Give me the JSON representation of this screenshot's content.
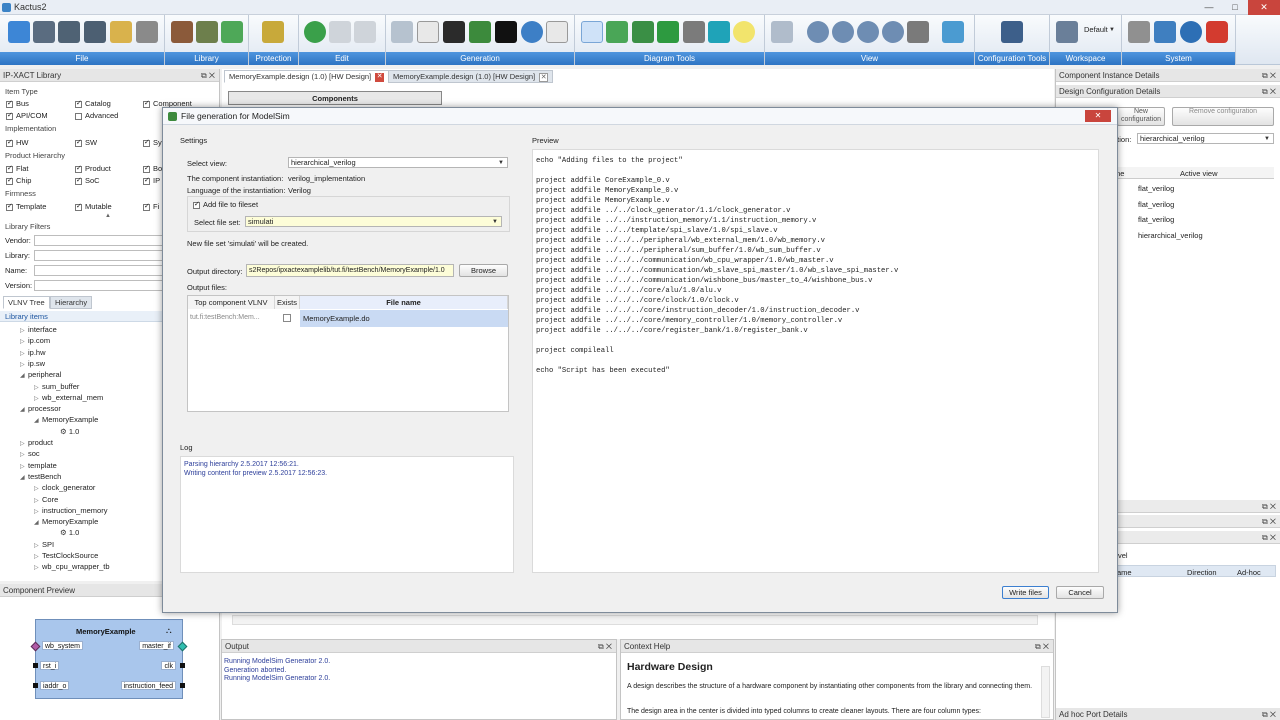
{
  "window": {
    "title": "Kactus2",
    "min": "—",
    "max": "□",
    "close": "✕"
  },
  "ribbon": {
    "groups": [
      "File",
      "Library",
      "Protection",
      "Edit",
      "Generation",
      "Diagram Tools",
      "View",
      "Configuration Tools",
      "Workspace",
      "System"
    ],
    "workspace_value": "Default"
  },
  "ip_library": {
    "title": "IP-XACT Library",
    "item_type_label": "Item Type",
    "item_types": [
      "Bus",
      "Catalog",
      "Component",
      "API/COM",
      "Advanced"
    ],
    "implementation_label": "Implementation",
    "implementations": [
      "HW",
      "SW",
      "Sy"
    ],
    "hierarchy_label": "Product Hierarchy",
    "hierarchies": [
      "Flat",
      "Product",
      "Bo",
      "Chip",
      "SoC",
      "IP"
    ],
    "firmness_label": "Firmness",
    "firmness": [
      "Template",
      "Mutable",
      "Fi"
    ],
    "filters_label": "Library Filters",
    "filter_fields": [
      "Vendor:",
      "Library:",
      "Name:",
      "Version:"
    ],
    "tabs": [
      "VLNV Tree",
      "Hierarchy"
    ],
    "tree_header": "Library items",
    "tree": [
      {
        "label": "interface",
        "level": 1,
        "open": false
      },
      {
        "label": "ip.com",
        "level": 1,
        "open": false
      },
      {
        "label": "ip.hw",
        "level": 1,
        "open": false
      },
      {
        "label": "ip.sw",
        "level": 1,
        "open": false
      },
      {
        "label": "peripheral",
        "level": 1,
        "open": true
      },
      {
        "label": "sum_buffer",
        "level": 2,
        "open": false
      },
      {
        "label": "wb_external_mem",
        "level": 2,
        "open": false
      },
      {
        "label": "processor",
        "level": 1,
        "open": true
      },
      {
        "label": "MemoryExample",
        "level": 2,
        "open": true
      },
      {
        "label": "1.0",
        "level": 3,
        "open": false,
        "icon": true
      },
      {
        "label": "product",
        "level": 1,
        "open": false
      },
      {
        "label": "soc",
        "level": 1,
        "open": false
      },
      {
        "label": "template",
        "level": 1,
        "open": false
      },
      {
        "label": "testBench",
        "level": 1,
        "open": true
      },
      {
        "label": "clock_generator",
        "level": 2,
        "open": false
      },
      {
        "label": "Core",
        "level": 2,
        "open": false
      },
      {
        "label": "instruction_memory",
        "level": 2,
        "open": false
      },
      {
        "label": "MemoryExample",
        "level": 2,
        "open": true
      },
      {
        "label": "1.0",
        "level": 3,
        "open": false,
        "icon": true
      },
      {
        "label": "SPI",
        "level": 2,
        "open": false
      },
      {
        "label": "TestClockSource",
        "level": 2,
        "open": false
      },
      {
        "label": "wb_cpu_wrapper_tb",
        "level": 2,
        "open": false
      }
    ]
  },
  "component_preview": {
    "title": "Component Preview",
    "name": "MemoryExample",
    "ports_left": [
      "wb_system",
      "rst_i",
      "iaddr_o"
    ],
    "ports_right": [
      "master_if",
      "clk",
      "instruction_feed"
    ]
  },
  "doc_tabs": [
    "MemoryExample.design (1.0) [HW Design]",
    "MemoryExample.design (1.0) [HW Design]"
  ],
  "components_header": "Components",
  "right_panels": {
    "instance_details": "Component Instance Details",
    "design_config": "Design Configuration Details",
    "new_config_btn": "New configuration",
    "remove_config_btn": "Remove configuration",
    "active_view_prefix": "ation:",
    "active_view_value": "hierarchical_verilog",
    "table_headers": [
      "me",
      "Active view"
    ],
    "active_views": [
      "flat_verilog",
      "flat_verilog",
      "flat_verilog",
      "hierarchical_verilog"
    ],
    "ports_headers": [
      "ame",
      "Direction",
      "Ad-hoc"
    ],
    "level_label": "vel",
    "adhoc_title": "Ad hoc Port Details"
  },
  "output": {
    "title": "Output",
    "lines": [
      "Running ModelSim Generator 2.0.",
      "Generation aborted.",
      "Running ModelSim Generator 2.0."
    ]
  },
  "context_help": {
    "title": "Context Help",
    "heading": "Hardware Design",
    "p1": "A design describes the structure of a hardware component by instantiating other components from the library and connecting them.",
    "p2": "The design area in the center is divided into typed columns to create cleaner layouts. There are four column types:"
  },
  "dialog": {
    "title": "File generation for ModelSim",
    "settings_label": "Settings",
    "select_view_label": "Select view:",
    "select_view_value": "hierarchical_verilog",
    "comp_inst_label": "The component instantiation:",
    "comp_inst_value": "verilog_implementation",
    "lang_label": "Language of the instantiation:",
    "lang_value": "Verilog",
    "add_fileset_label": "Add file to fileset",
    "select_fileset_label": "Select file set:",
    "select_fileset_value": "simulati",
    "new_set_note": "New file set 'simulati' will be created.",
    "output_dir_label": "Output directory:",
    "output_dir_value": "s2Repos/ipxactexamplelib/tut.fi/testBench/MemoryExample/1.0",
    "browse_btn": "Browse",
    "output_files_label": "Output files:",
    "out_headers": [
      "Top component VLNV",
      "Exists",
      "File name"
    ],
    "out_row": {
      "vlnv": "tut.fi:testBench:Mem...",
      "file": "MemoryExample.do"
    },
    "log_label": "Log",
    "log_lines": [
      "Parsing hierarchy 2.5.2017 12:56:21.",
      "Writing content for preview 2.5.2017 12:56:23."
    ],
    "preview_label": "Preview",
    "preview_text": "echo \"Adding files to the project\"\n\nproject addfile CoreExample_0.v\nproject addfile MemoryExample_0.v\nproject addfile MemoryExample.v\nproject addfile ../../clock_generator/1.1/clock_generator.v\nproject addfile ../../instruction_memory/1.1/instruction_memory.v\nproject addfile ../../template/spi_slave/1.0/spi_slave.v\nproject addfile ../../../peripheral/wb_external_mem/1.0/wb_memory.v\nproject addfile ../../../peripheral/sum_buffer/1.0/wb_sum_buffer.v\nproject addfile ../../../communication/wb_cpu_wrapper/1.0/wb_master.v\nproject addfile ../../../communication/wb_slave_spi_master/1.0/wb_slave_spi_master.v\nproject addfile ../../../communication/wishbone_bus/master_to_4/wishbone_bus.v\nproject addfile ../../../core/alu/1.0/alu.v\nproject addfile ../../../core/clock/1.0/clock.v\nproject addfile ../../../core/instruction_decoder/1.0/instruction_decoder.v\nproject addfile ../../../core/memory_controller/1.0/memory_controller.v\nproject addfile ../../../core/register_bank/1.0/register_bank.v\n\nproject compileall\n\necho \"Script has been executed\"",
    "write_btn": "Write files",
    "cancel_btn": "Cancel"
  }
}
